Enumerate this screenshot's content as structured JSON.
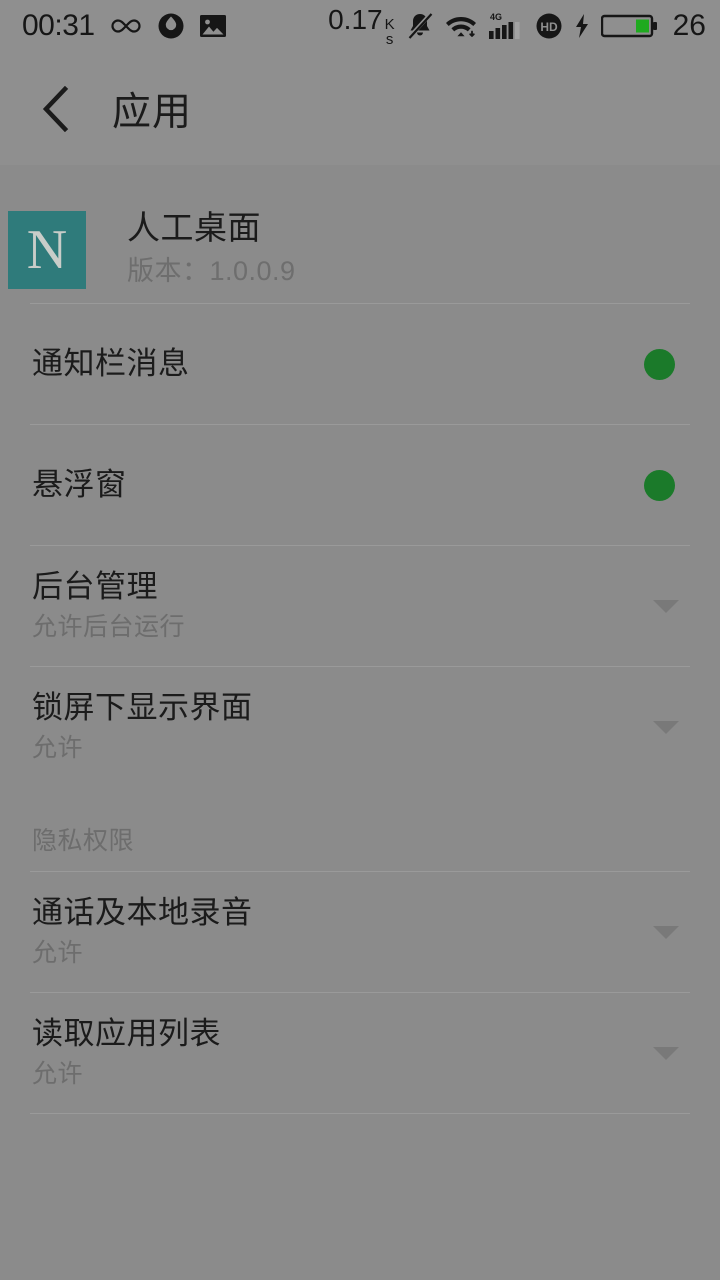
{
  "statusbar": {
    "time": "00:31",
    "left_icons": [
      {
        "name": "infinity-icon",
        "label": "∞"
      },
      {
        "name": "droplet-face-icon",
        "label": ""
      },
      {
        "name": "gallery-image-icon",
        "label": ""
      }
    ],
    "network_speed": "0.17",
    "network_speed_unit_top": "K",
    "network_speed_unit_bottom": "s",
    "right_icons": [
      {
        "name": "mute-bell-icon",
        "label": ""
      },
      {
        "name": "wifi-icon",
        "label": ""
      },
      {
        "name": "signal-4g-icon",
        "label": "4G"
      },
      {
        "name": "volte-hd-icon",
        "label": "HD"
      },
      {
        "name": "charging-bolt-icon",
        "label": ""
      },
      {
        "name": "battery-icon",
        "label": ""
      }
    ],
    "battery_percent": "26"
  },
  "header": {
    "back_label": "返回",
    "title": "应用"
  },
  "app": {
    "icon_letter": "N",
    "icon_color": "#2f7b7b",
    "name": "人工桌面",
    "version": "版本：1.0.0.9"
  },
  "colors": {
    "background": "#8b8b8b",
    "toggle_on": "#1b7a2a",
    "caret": "#797979",
    "divider": "#9a9a9a",
    "title_text": "#1b1b1b",
    "sub_text": "#6d6d6d"
  },
  "settings": [
    {
      "title": "通知栏消息",
      "subtitle": "",
      "control": "toggle",
      "state": "on"
    },
    {
      "title": "悬浮窗",
      "subtitle": "",
      "control": "toggle",
      "state": "on"
    },
    {
      "title": "后台管理",
      "subtitle": "允许后台运行",
      "control": "select"
    },
    {
      "title": "锁屏下显示界面",
      "subtitle": "允许",
      "control": "select"
    }
  ],
  "privacy_section": {
    "header": "隐私权限",
    "items": [
      {
        "title": "通话及本地录音",
        "subtitle": "允许",
        "control": "select"
      },
      {
        "title": "读取应用列表",
        "subtitle": "允许",
        "control": "select"
      }
    ]
  }
}
